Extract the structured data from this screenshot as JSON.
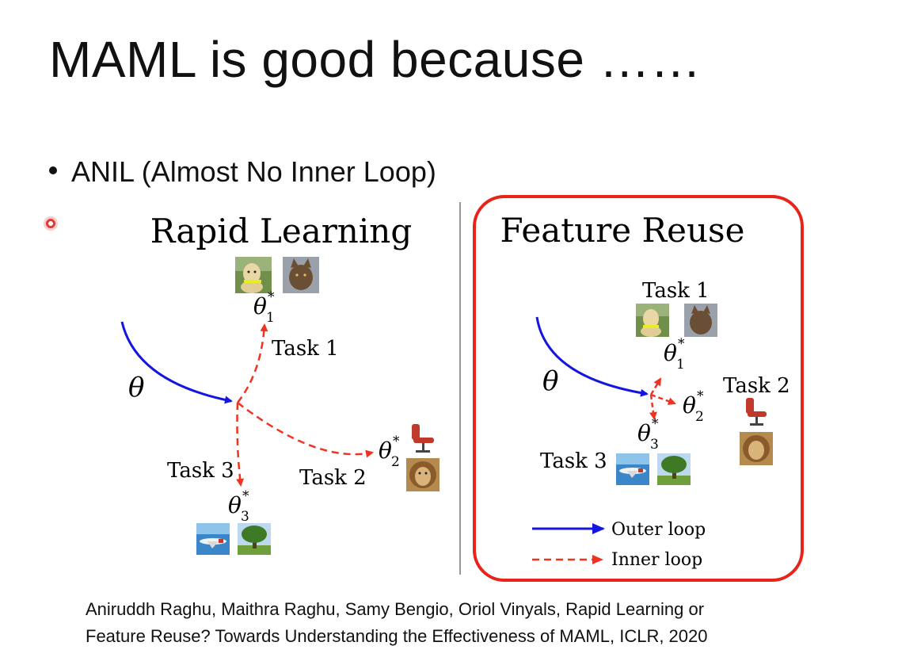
{
  "slide": {
    "title": "MAML is good because ……",
    "bullet": "ANIL (Almost No Inner Loop)"
  },
  "left_panel": {
    "title": "Rapid Learning",
    "theta": "θ",
    "task1": "Task 1",
    "task2": "Task 2",
    "task3": "Task 3",
    "theta1": "θ",
    "theta1_sub": "1",
    "theta2": "θ",
    "theta2_sub": "2",
    "theta3": "θ",
    "theta3_sub": "3",
    "star": "*"
  },
  "right_panel": {
    "title": "Feature Reuse",
    "theta": "θ",
    "task1": "Task 1",
    "task2": "Task 2",
    "task3": "Task 3",
    "theta1": "θ",
    "theta1_sub": "1",
    "theta2": "θ",
    "theta2_sub": "2",
    "theta3": "θ",
    "theta3_sub": "3",
    "star": "*",
    "legend_outer": "Outer loop",
    "legend_inner": "Inner loop"
  },
  "citation": {
    "line1": "Aniruddh Raghu, Maithra Raghu, Samy Bengio, Oriol Vinyals, Rapid Learning or",
    "line2": "Feature Reuse? Towards Understanding the Effectiveness of MAML, ICLR, 2020"
  },
  "colors": {
    "outer_loop": "#1515e0",
    "inner_loop": "#ee3322",
    "highlight_box": "#e8231a"
  },
  "icons": [
    "dog-image-icon",
    "cat-image-icon",
    "chair-icon",
    "lion-image-icon",
    "airplane-image-icon",
    "tree-image-icon"
  ]
}
